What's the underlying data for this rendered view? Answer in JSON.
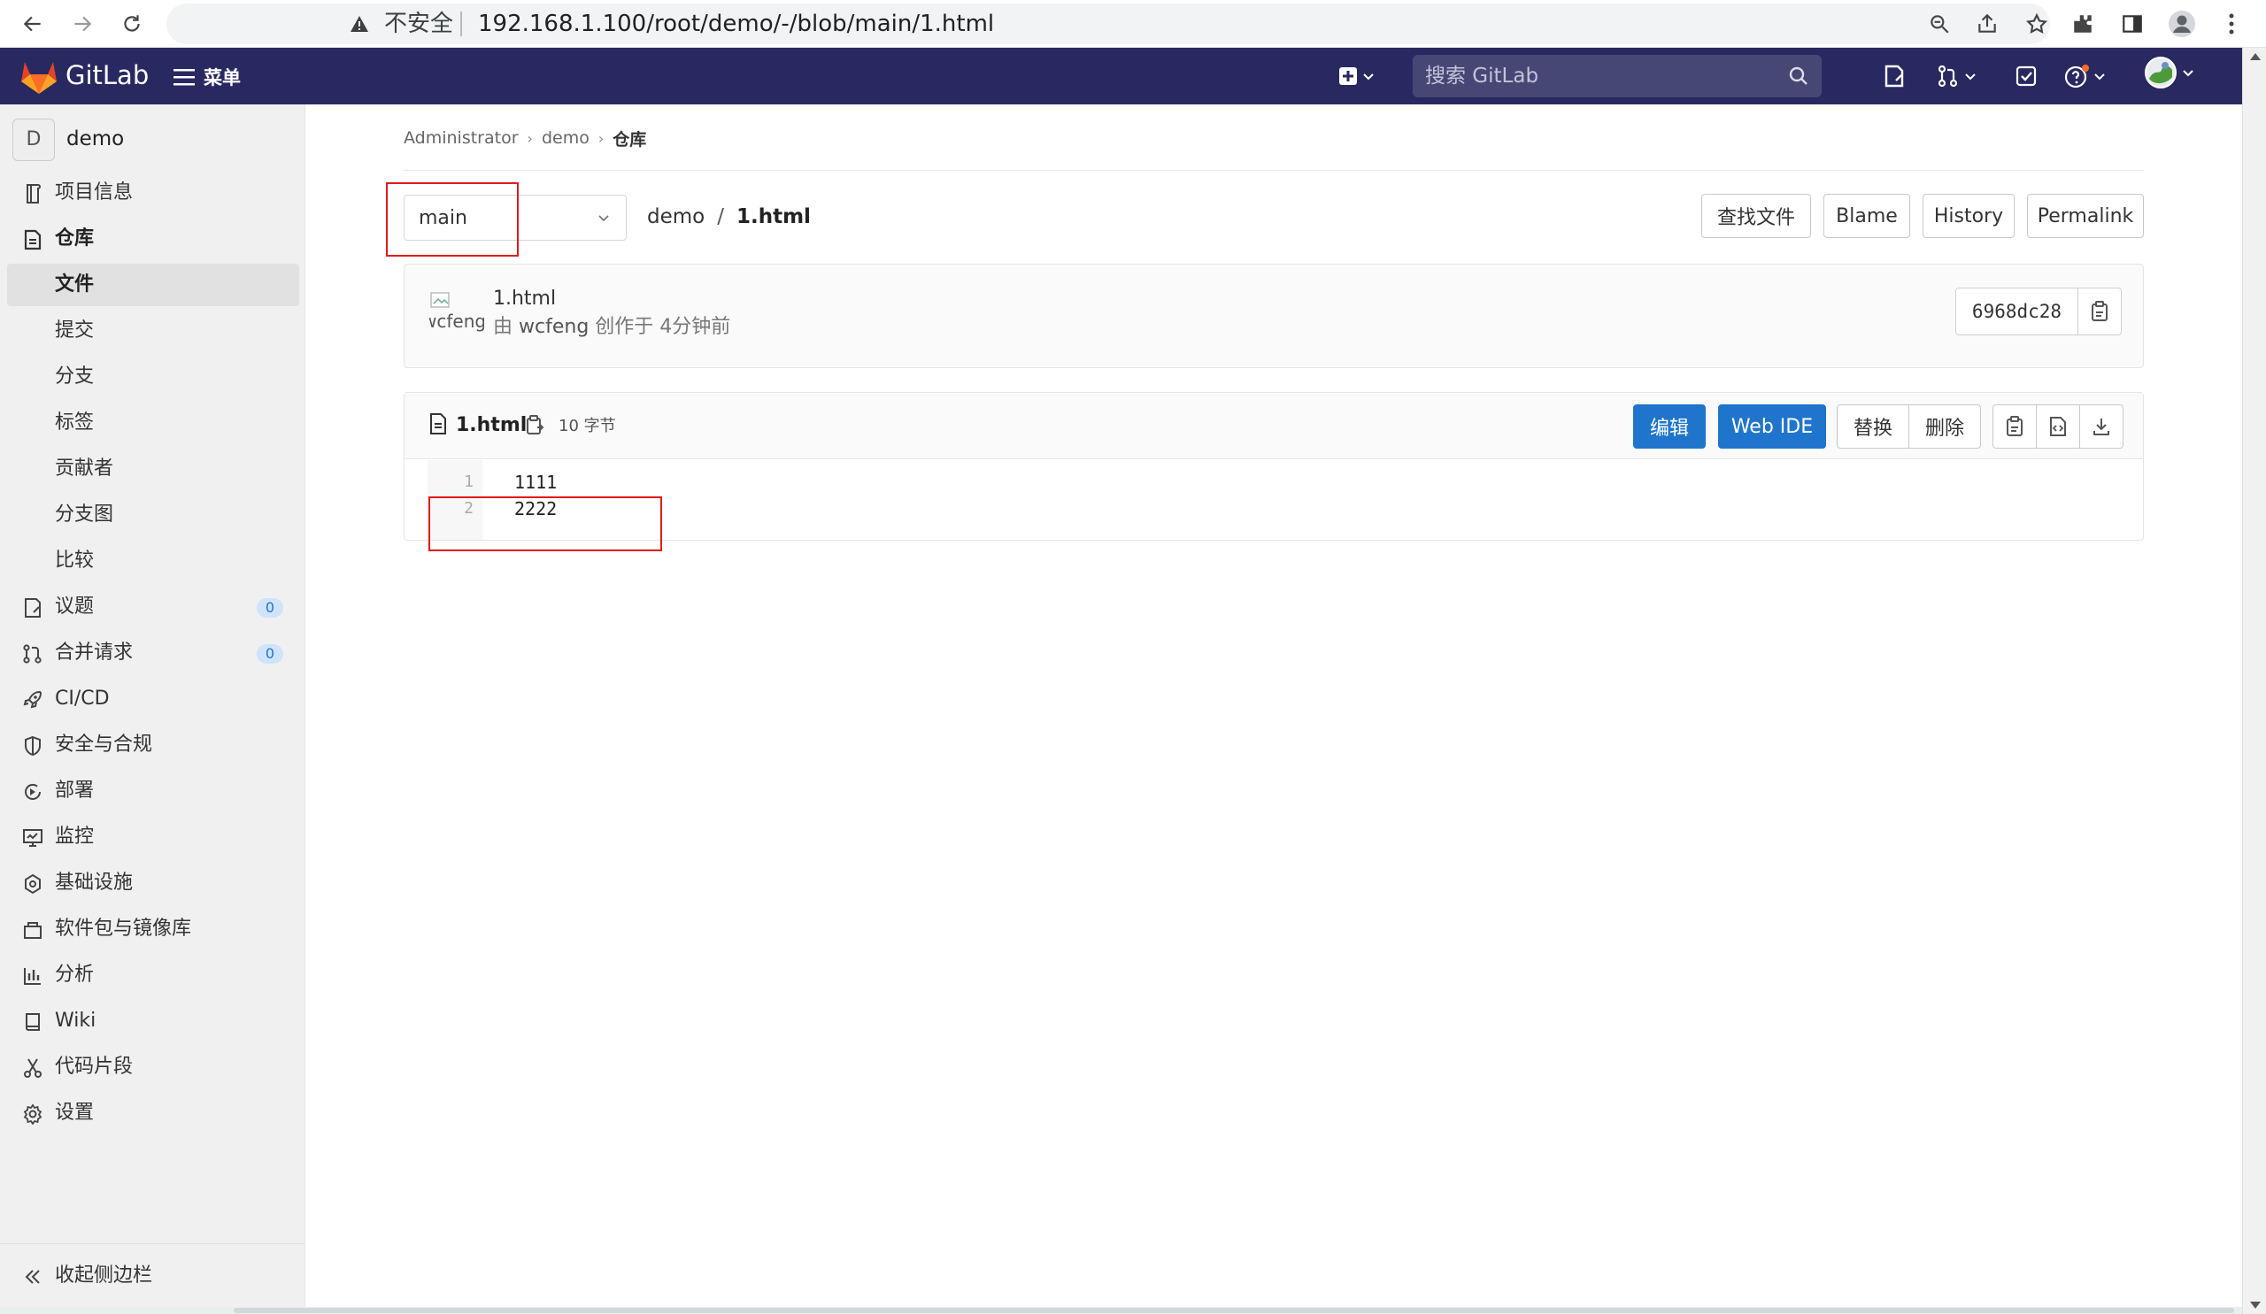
{
  "browser": {
    "security_label": "不安全",
    "url": "192.168.1.100/root/demo/-/blob/main/1.html"
  },
  "header": {
    "brand": "GitLab",
    "menu_label": "菜单",
    "search_placeholder": "搜索 GitLab"
  },
  "sidebar": {
    "project_initial": "D",
    "project_name": "demo",
    "items": [
      {
        "label": "项目信息",
        "icon": "project-info-icon"
      },
      {
        "label": "仓库",
        "icon": "repository-icon"
      },
      {
        "label": "文件"
      },
      {
        "label": "提交"
      },
      {
        "label": "分支"
      },
      {
        "label": "标签"
      },
      {
        "label": "贡献者"
      },
      {
        "label": "分支图"
      },
      {
        "label": "比较"
      },
      {
        "label": "议题",
        "icon": "issues-icon",
        "badge": "0"
      },
      {
        "label": "合并请求",
        "icon": "merge-request-icon",
        "badge": "0"
      },
      {
        "label": "CI/CD",
        "icon": "rocket-icon"
      },
      {
        "label": "安全与合规",
        "icon": "shield-icon"
      },
      {
        "label": "部署",
        "icon": "deploy-icon"
      },
      {
        "label": "监控",
        "icon": "monitor-icon"
      },
      {
        "label": "基础设施",
        "icon": "cloud-gear-icon"
      },
      {
        "label": "软件包与镜像库",
        "icon": "package-icon"
      },
      {
        "label": "分析",
        "icon": "chart-icon"
      },
      {
        "label": "Wiki",
        "icon": "book-icon"
      },
      {
        "label": "代码片段",
        "icon": "snippet-icon"
      },
      {
        "label": "设置",
        "icon": "gear-icon"
      }
    ],
    "collapse_label": "收起侧边栏"
  },
  "breadcrumb": [
    "Administrator",
    "demo",
    "仓库"
  ],
  "repo": {
    "branch": "main",
    "path_root": "demo",
    "path_file": "1.html",
    "actions": {
      "find_file": "查找文件",
      "blame": "Blame",
      "history": "History",
      "permalink": "Permalink"
    }
  },
  "commit": {
    "avatar_alt": "wcfeng",
    "title": "1.html",
    "by": "由",
    "author": "wcfeng",
    "created": "创作于 4分钟前",
    "sha": "6968dc28"
  },
  "file": {
    "name": "1.html",
    "size": "10 字节",
    "actions": {
      "edit": "编辑",
      "web_ide": "Web IDE",
      "replace": "替换",
      "delete": "删除"
    },
    "lines": [
      {
        "number": "1",
        "text": "1111"
      },
      {
        "number": "2",
        "text": "2222"
      }
    ]
  }
}
